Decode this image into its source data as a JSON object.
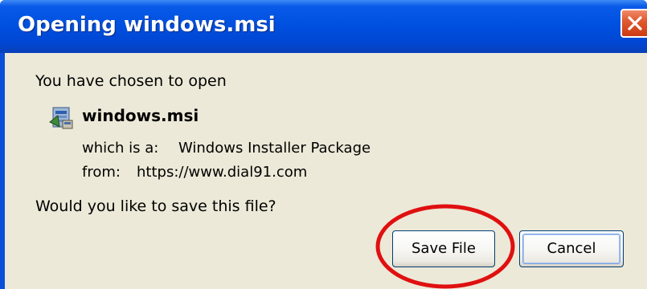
{
  "window": {
    "title": "Opening windows.msi"
  },
  "dialog": {
    "intro": "You have chosen to open",
    "file_name": "windows.msi",
    "which_label": "which is a:",
    "which_value": "Windows Installer Package",
    "from_label": "from:",
    "from_value": "https://www.dial91.com",
    "question": "Would you like to save this file?"
  },
  "buttons": {
    "save_label": "Save File",
    "cancel_label": "Cancel"
  },
  "icons": {
    "close": "close-icon",
    "file": "msi-installer-icon"
  },
  "colors": {
    "titlebar": "#0051e0",
    "client_bg": "#ece9d8",
    "close_button": "#e05a30",
    "annotation": "#e01010"
  }
}
